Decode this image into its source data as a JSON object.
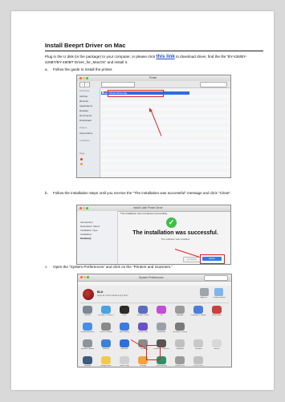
{
  "title": "Install Beeprt Driver on Mac",
  "intro": {
    "before_link": "Plug in the U disk (in the package) to your computer, or please click ",
    "link_text": "this link",
    "after_link": " to download driver, find the file “BY-426/BY-426BT/BY-480BT Driver_for_MacOS” and install it."
  },
  "steps": [
    {
      "marker": "a.",
      "text": "Follow the guide to install the printer."
    },
    {
      "marker": "b.",
      "text": "Follow the installation steps until you receive the “The installation was successful” message and click “Close”."
    },
    {
      "marker": "c.",
      "text": "Open the “System Preferences” and click on the “Printers and Scanners.”"
    }
  ],
  "screenshot1": {
    "window_title": "Printer",
    "file_name": "Label Printer Driver.pkg",
    "sidebar": [
      "Favorites",
      "AirDrop",
      "Recents",
      "Applications",
      "Desktop",
      "Documents",
      "Downloads",
      "iCloud",
      "iCloud Drive",
      "Locations",
      "Tags"
    ]
  },
  "screenshot2": {
    "window_title": "Install Label Printer Driver",
    "header": "The installation was completed successfully.",
    "steps": [
      "Introduction",
      "Destination Select",
      "Installation Type",
      "Installation",
      "Summary"
    ],
    "message": "The installation was successful.",
    "submessage": "The software was installed.",
    "go_back": "Go Back",
    "close": "Close"
  },
  "screenshot3": {
    "window_title": "System Preferences",
    "user_name": "BLU",
    "user_sub": "Apple ID, iCloud, Media & App Store",
    "top_icons": [
      "Apple ID",
      "Family Sharing"
    ],
    "icons": [
      "General",
      "Desktop & Screen Saver",
      "Dock",
      "Mission Control",
      "Siri",
      "Spotlight",
      "Language & Region",
      "Notifications",
      "Internet Accounts",
      "Users & Groups",
      "Accessibility",
      "Screen Time",
      "Extensions",
      "Security & Privacy",
      "Software Update",
      "Network",
      "Bluetooth",
      "Sound",
      "Printers & Scanners",
      "Keyboard",
      "Trackpad",
      "Mouse",
      "Displays",
      "Energy Saver",
      "Date & Time",
      "Sharing",
      "Time Machine",
      "Startup Disk",
      "CDs & DVDs"
    ]
  }
}
